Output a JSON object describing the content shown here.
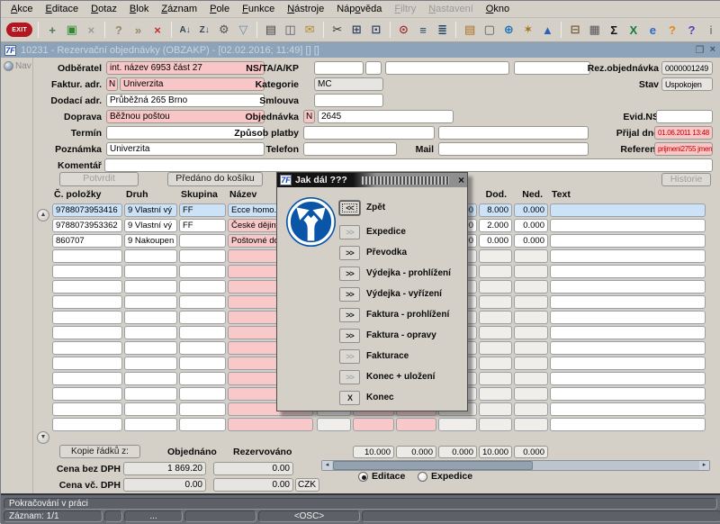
{
  "window": {
    "title": "10231 - Rezervační objednávky (OBZAKP) - [02.02.2016; 11:49] [] []",
    "logo": "7F",
    "restore_icon": "❐",
    "close_icon": "×"
  },
  "menu": {
    "items": [
      {
        "label": "Akce",
        "u": 0
      },
      {
        "label": "Editace",
        "u": 0
      },
      {
        "label": "Dotaz",
        "u": 0
      },
      {
        "label": "Blok",
        "u": 0
      },
      {
        "label": "Záznam",
        "u": 0
      },
      {
        "label": "Pole",
        "u": 0
      },
      {
        "label": "Funkce",
        "u": 0
      },
      {
        "label": "Nástroje",
        "u": 0
      },
      {
        "label": "Nápověda",
        "u": 3
      },
      {
        "label": "Filtry",
        "u": 0,
        "disabled": true
      },
      {
        "label": "Nastavení",
        "u": 0,
        "disabled": true
      },
      {
        "label": "Okno",
        "u": 0
      }
    ]
  },
  "toolbar": {
    "icons": [
      {
        "name": "exit-icon",
        "glyph": "EXIT",
        "exit": true
      },
      {
        "sep": true
      },
      {
        "name": "insert-record-icon",
        "glyph": "+",
        "color": "#4a7a5a"
      },
      {
        "name": "save-icon",
        "glyph": "▣",
        "color": "#2d8a2d"
      },
      {
        "name": "cancel-icon",
        "glyph": "×",
        "color": "#9a9a9a"
      },
      {
        "sep": true
      },
      {
        "name": "enter-query-icon",
        "glyph": "?",
        "color": "#97886c"
      },
      {
        "name": "execute-query-icon",
        "glyph": "»",
        "color": "#97886c"
      },
      {
        "name": "cancel-query-icon",
        "glyph": "×",
        "color": "#c03030"
      },
      {
        "sep": true
      },
      {
        "name": "sort-asc-icon",
        "glyph": "A↓",
        "color": "#334455",
        "small": true
      },
      {
        "name": "sort-desc-icon",
        "glyph": "Z↓",
        "color": "#334455",
        "small": true
      },
      {
        "name": "wrench-icon",
        "glyph": "⚙",
        "color": "#555555"
      },
      {
        "name": "filter-icon",
        "glyph": "▽",
        "color": "#6688aa"
      },
      {
        "sep": true
      },
      {
        "name": "print-icon",
        "glyph": "▤",
        "color": "#444444"
      },
      {
        "name": "print-preview-icon",
        "glyph": "◫",
        "color": "#555566"
      },
      {
        "name": "mail-icon",
        "glyph": "✉",
        "color": "#b58a2a"
      },
      {
        "sep": true
      },
      {
        "name": "cut-icon",
        "glyph": "✂",
        "color": "#333333"
      },
      {
        "name": "copy-icon",
        "glyph": "⊞",
        "color": "#334466"
      },
      {
        "name": "paste-icon",
        "glyph": "⊡",
        "color": "#334466"
      },
      {
        "sep": true
      },
      {
        "name": "zoom-icon",
        "glyph": "⊙",
        "color": "#a03030"
      },
      {
        "name": "list-icon",
        "glyph": "≡",
        "color": "#224466"
      },
      {
        "name": "tree-icon",
        "glyph": "≣",
        "color": "#224466"
      },
      {
        "sep": true
      },
      {
        "name": "card-icon",
        "glyph": "▤",
        "color": "#b06a1a"
      },
      {
        "name": "document-icon",
        "glyph": "▢",
        "color": "#555555"
      },
      {
        "name": "globe-icon",
        "glyph": "⊕",
        "color": "#1a72b8"
      },
      {
        "name": "wheel-icon",
        "glyph": "✶",
        "color": "#a5711a"
      },
      {
        "name": "mountain-icon",
        "glyph": "▲",
        "color": "#2a62b8"
      },
      {
        "sep": true
      },
      {
        "name": "cart-icon",
        "glyph": "⊟",
        "color": "#7a5a3a"
      },
      {
        "name": "calculator-icon",
        "glyph": "▦",
        "color": "#555555"
      },
      {
        "name": "sigma-icon",
        "glyph": "Σ",
        "color": "#111111"
      },
      {
        "name": "excel-icon",
        "glyph": "X",
        "color": "#1a7a3a"
      },
      {
        "name": "explorer-icon",
        "glyph": "e",
        "color": "#2a66cc"
      },
      {
        "name": "help-orange-icon",
        "glyph": "?",
        "color": "#e08a1a"
      },
      {
        "name": "help-purple-icon",
        "glyph": "?",
        "color": "#5a3ab8"
      },
      {
        "name": "info-icon",
        "glyph": "i",
        "color": "#8a8a8a"
      }
    ]
  },
  "nav": {
    "label": "Nav"
  },
  "form": {
    "odberatel": {
      "label": "Odběratel",
      "value": "int. název 6953 část 27"
    },
    "faktur": {
      "label": "Faktur. adr.",
      "flag": "N",
      "value": "Univerzita"
    },
    "dodaci": {
      "label": "Dodací adr.",
      "value": "Průběžná 265 Brno"
    },
    "doprava": {
      "label": "Doprava",
      "value": "Běžnou poštou"
    },
    "termin": {
      "label": "Termín",
      "value": ""
    },
    "poznamka": {
      "label": "Poznámka",
      "value": "Univerzita"
    },
    "komentar": {
      "label": "Komentář",
      "value": ""
    },
    "ns": {
      "label": "NS/TA/A/KP",
      "values": [
        "",
        "",
        "",
        ""
      ]
    },
    "kategorie": {
      "label": "Kategorie",
      "value": "MC"
    },
    "smlouva": {
      "label": "Smlouva",
      "value": ""
    },
    "objednavka": {
      "label": "Objednávka",
      "flag": "N",
      "value": "2645"
    },
    "zpusob": {
      "label": "Způsob platby",
      "value": "",
      "value2": ""
    },
    "telefon": {
      "label": "Telefon",
      "value": ""
    },
    "mail": {
      "label": "Mail",
      "value": ""
    },
    "rez": {
      "label": "Rez.objednávka",
      "value": "0000001249"
    },
    "stav": {
      "label": "Stav",
      "value": "Uspokojen"
    },
    "evidns": {
      "label": "Evid.NS",
      "value": ""
    },
    "prijal": {
      "label": "Přijal dne",
      "value": "01.06.2011 13:48"
    },
    "referent": {
      "label": "Referent",
      "value": "prijmeni2755 jmen"
    }
  },
  "actions": {
    "potvrdit": "Potvrdit",
    "predano": "Předáno do košíku",
    "historie": "Historie"
  },
  "table": {
    "headers": [
      "Č. položky",
      "Druh",
      "Skupina",
      "Název",
      "",
      "",
      "",
      "",
      "Dod.",
      "Ned.",
      "Text"
    ],
    "rows": [
      {
        "selected": true,
        "cells": [
          "9788073953416",
          "9 Vlastní vý",
          "FF",
          "Ecce homo. Esej",
          "",
          "",
          "",
          "0.000",
          "8.000",
          "0.000",
          ""
        ]
      },
      {
        "selected": false,
        "cells": [
          "9788073953362",
          "9 Vlastní vý",
          "FF",
          "České dějiny ve",
          "",
          "",
          "",
          "0.000",
          "2.000",
          "0.000",
          ""
        ]
      },
      {
        "selected": false,
        "cells": [
          "860707",
          "9 Nakoupen",
          "",
          "Poštovné do 2 k",
          "",
          "",
          "",
          "0.000",
          "0.000",
          "0.000",
          ""
        ]
      }
    ],
    "empty_rows": 12,
    "totals": [
      "10.000",
      "0.000",
      "0.000",
      "10.000",
      "0.000"
    ]
  },
  "bottom": {
    "kopie": "Kopie řádků z:",
    "objednano_label": "Objednáno",
    "rezervovano_label": "Rezervováno",
    "cena_bez_label": "Cena bez DPH",
    "cena_vc_label": "Cena vč. DPH",
    "cena_bez_1": "1 869.20",
    "cena_bez_2": "0.00",
    "cena_vc_1": "0.00",
    "cena_vc_2": "0.00",
    "currency": "CZK"
  },
  "radios": {
    "editace": "Editace",
    "expedice": "Expedice",
    "selected": "editace"
  },
  "dialog": {
    "title": "Jak dál ???",
    "logo": "7F",
    "close_icon": "×",
    "buttons": [
      {
        "glyph": "<<",
        "label": "Zpět",
        "state": "focus"
      },
      {
        "glyph": ">>",
        "label": "Expedice",
        "state": "disabled"
      },
      {
        "glyph": ">>",
        "label": "Převodka",
        "state": "enabled"
      },
      {
        "glyph": ">>",
        "label": "Výdejka - prohlížení",
        "state": "enabled"
      },
      {
        "glyph": ">>",
        "label": "Výdejka - vyřízení",
        "state": "enabled"
      },
      {
        "glyph": ">>",
        "label": "Faktura - prohlížení",
        "state": "enabled"
      },
      {
        "glyph": ">>",
        "label": "Faktura - opravy",
        "state": "enabled"
      },
      {
        "glyph": ">>",
        "label": "Fakturace",
        "state": "disabled"
      },
      {
        "glyph": ">>",
        "label": "Konec + uložení",
        "state": "disabled"
      },
      {
        "glyph": "X",
        "label": "Konec",
        "state": "enabled"
      }
    ]
  },
  "statusbar": {
    "line1": "Pokračování v práci",
    "segments": [
      "Záznam: 1/1",
      "",
      "...",
      "",
      "<OSC>",
      ""
    ]
  }
}
